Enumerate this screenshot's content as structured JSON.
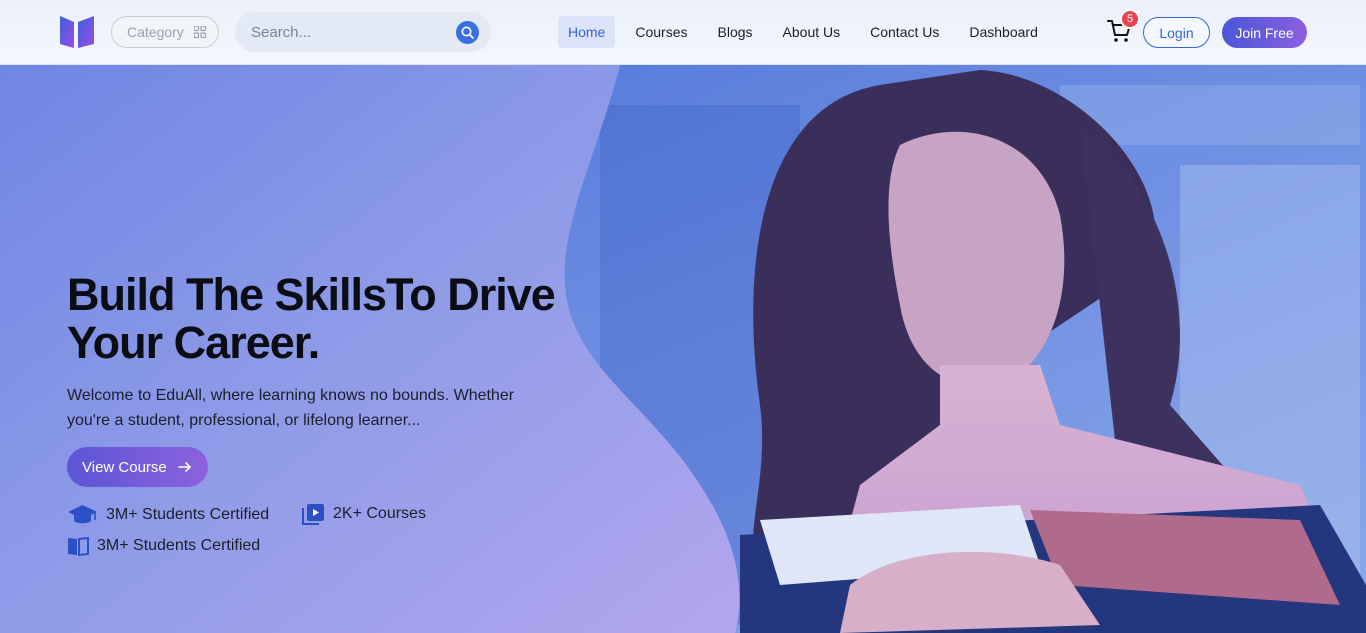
{
  "header": {
    "category_label": "Category",
    "search_placeholder": "Search...",
    "nav": [
      {
        "label": "Home",
        "active": true
      },
      {
        "label": "Courses",
        "active": false
      },
      {
        "label": "Blogs",
        "active": false
      },
      {
        "label": "About Us",
        "active": false
      },
      {
        "label": "Contact Us",
        "active": false
      },
      {
        "label": "Dashboard",
        "active": false
      }
    ],
    "cart_count": "5",
    "login_label": "Login",
    "join_label": "Join Free"
  },
  "hero": {
    "title_line1": "Build The SkillsTo Drive",
    "title_line2": "Your Career.",
    "description_line1": "Welcome to EduAll, where learning knows no bounds. Whether",
    "description_line2": "you're a student, professional, or lifelong learner...",
    "cta_label": "View Course",
    "stats": [
      {
        "icon": "graduation-cap-icon",
        "text": "3M+ Students Certified"
      },
      {
        "icon": "video-play-icon",
        "text": "2K+ Courses"
      },
      {
        "icon": "book-icon",
        "text": "3M+ Students Certified"
      }
    ]
  },
  "colors": {
    "accent": "#3b64d6",
    "gradient_start": "#4b56d8",
    "gradient_end": "#8a5fe0",
    "badge": "#e8434f"
  }
}
